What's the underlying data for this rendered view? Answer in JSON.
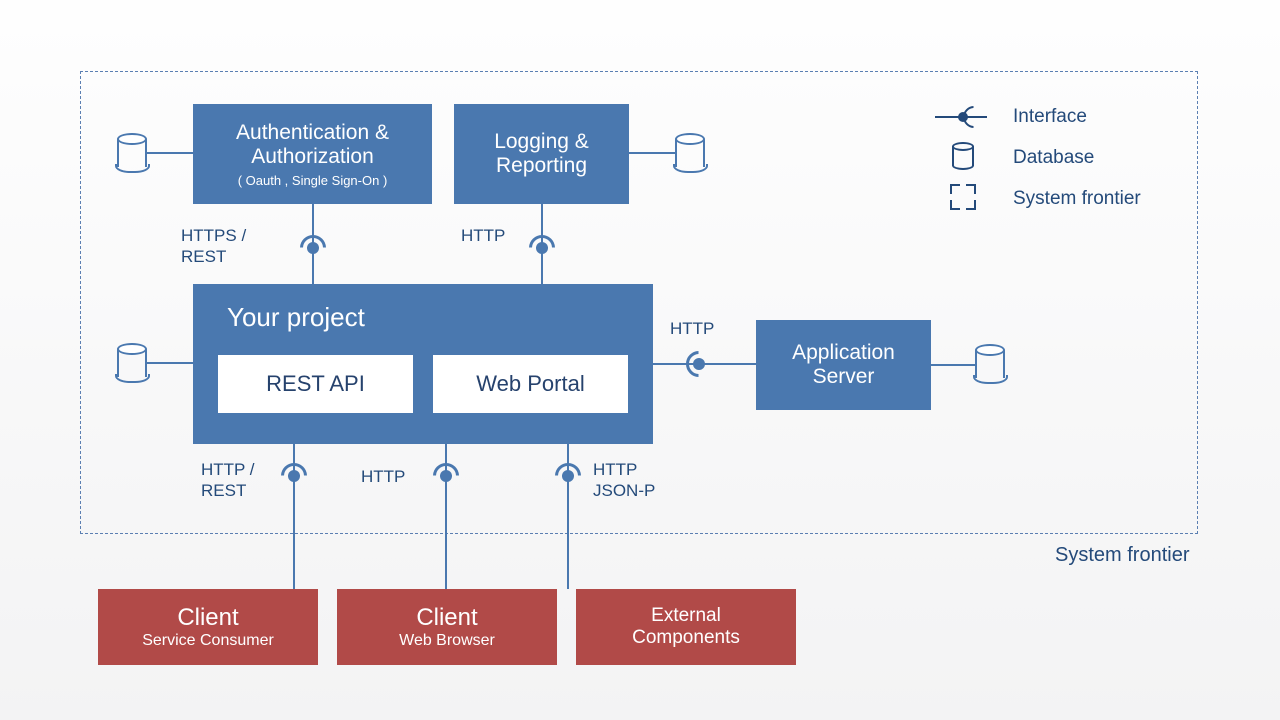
{
  "frontier_label": "System frontier",
  "boxes": {
    "auth": {
      "title": "Authentication & Authorization",
      "subtitle": "( Oauth , Single Sign-On )"
    },
    "logging": {
      "title": "Logging & Reporting"
    },
    "project": {
      "title": "Your project",
      "sub1": "REST  API",
      "sub2": "Web Portal"
    },
    "appserver": {
      "title": "Application Server"
    },
    "client1": {
      "title": "Client",
      "subtitle": "Service Consumer"
    },
    "client2": {
      "title": "Client",
      "subtitle": "Web Browser"
    },
    "external": {
      "title": "External Components"
    }
  },
  "conn_labels": {
    "auth_down": "HTTPS / REST",
    "log_down": "HTTP",
    "appserver_left": "HTTP",
    "c1": "HTTP / REST",
    "c2": "HTTP",
    "c3": "HTTP\nJSON-P"
  },
  "legend": {
    "interface": "Interface",
    "database": "Database",
    "frontier": "System frontier"
  }
}
